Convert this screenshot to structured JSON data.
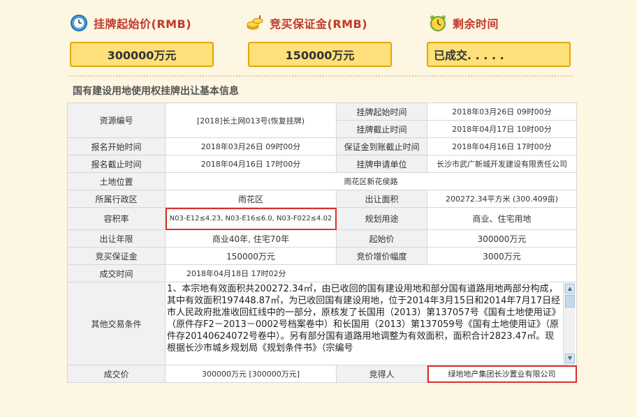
{
  "header": {
    "start_price_label": "挂牌起始价(RMB)",
    "deposit_label": "竞买保证金(RMB)",
    "remaining_label": "剩余时间",
    "start_price_value": "300000万元",
    "deposit_value": "150000万元",
    "remaining_value": "已成交. . . . ."
  },
  "section_title": "国有建设用地使用权挂牌出让基本信息",
  "table": {
    "resource_no_label": "资源编号",
    "resource_no_value": "[2018]长土网013号(恢复挂牌)",
    "listing_start_label": "挂牌起始时间",
    "listing_start_value": "2018年03月26日 09时00分",
    "listing_end_label": "挂牌截止时间",
    "listing_end_value": "2018年04月17日 10时00分",
    "reg_start_label": "报名开始时间",
    "reg_start_value": "2018年03月26日 09时00分",
    "deposit_deadline_label": "保证金到账截止时间",
    "deposit_deadline_value": "2018年04月16日 17时00分",
    "reg_end_label": "报名截止时间",
    "reg_end_value": "2018年04月16日 17时00分",
    "applicant_label": "挂牌申请单位",
    "applicant_value": "长沙市武广新城开发建设有限责任公司",
    "location_label": "土地位置",
    "location_value": "雨花区新花侯路",
    "district_label": "所属行政区",
    "district_value": "雨花区",
    "area_label": "出让面积",
    "area_value": "200272.34平方米 (300.409亩)",
    "far_label": "容积率",
    "far_value": "N03-E12≤4.23, N03-E16≤6.0, N03-F022≤4.02",
    "use_label": "规划用途",
    "use_value": "商业、住宅用地",
    "term_label": "出让年限",
    "term_value": "商业40年, 住宅70年",
    "start_price_label": "起始价",
    "start_price_value": "300000万元",
    "deposit_label": "竞买保证金",
    "deposit_value": "150000万元",
    "increment_label": "竞价增价幅度",
    "increment_value": "3000万元",
    "deal_time_label": "成交时间",
    "deal_time_value": "2018年04月18日 17时02分",
    "other_label": "其他交易条件",
    "other_value": "1、本宗地有效面积共200272.34㎡，由已收回的国有建设用地和部分国有道路用地两部分构成，其中有效面积197448.87㎡，为已收回国有建设用地，位于2014年3月15日和2014年7月17日经市人民政府批准收回红线中的一部分，原核发了长国用（2013）第137057号《国有土地使用证》（原件存F2－2013－0002号档案卷中）和长国用（2013）第137059号《国有土地使用证》（原件存20140624072号卷中）。另有部分国有道路用地调整为有效面积，面积合计2823.47㎡。现根据长沙市城乡规划局《规划条件书》（宗编号",
    "deal_price_label": "成交价",
    "deal_price_value": "300000万元 [300000万元]",
    "winner_label": "竞得人",
    "winner_value": "绿地地产集团长沙置业有限公司"
  },
  "colors": {
    "accent_red": "#c0392b",
    "box_fill": "#ffe07a",
    "highlight": "#d9302c"
  },
  "icons": [
    "clock-icon",
    "coins-icon",
    "alarm-clock-icon"
  ]
}
